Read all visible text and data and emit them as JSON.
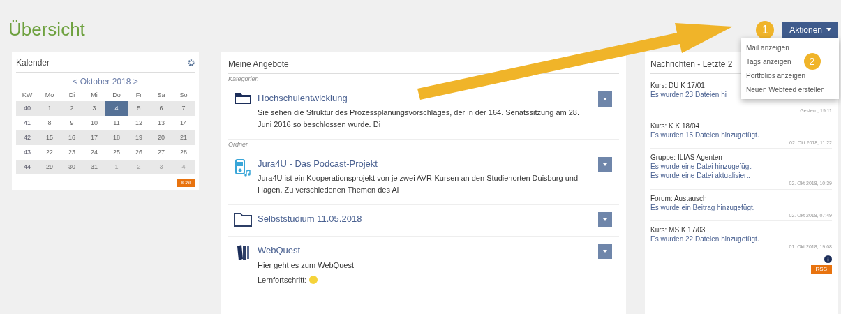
{
  "page": {
    "title": "Übersicht"
  },
  "callouts": [
    "1",
    "2"
  ],
  "actions": {
    "label": "Aktionen",
    "expanded": true,
    "menu": [
      "Mail anzeigen",
      "Tags anzeigen",
      "Portfolios anzeigen",
      "Neuen Webfeed erstellen"
    ]
  },
  "calendar": {
    "title": "Kalender",
    "month": "< Oktober 2018 >",
    "columns": [
      "KW",
      "Mo",
      "Di",
      "Mi",
      "Do",
      "Fr",
      "Sa",
      "So"
    ],
    "weeks": [
      {
        "kw": "40",
        "days": [
          {
            "label": "1",
            "selected": false,
            "other_month": false
          },
          {
            "label": "2",
            "selected": false,
            "other_month": false
          },
          {
            "label": "3",
            "selected": false,
            "other_month": false
          },
          {
            "label": "4",
            "selected": true,
            "other_month": false
          },
          {
            "label": "5",
            "selected": false,
            "other_month": false
          },
          {
            "label": "6",
            "selected": false,
            "other_month": false
          },
          {
            "label": "7",
            "selected": false,
            "other_month": false
          }
        ]
      },
      {
        "kw": "41",
        "days": [
          {
            "label": "8",
            "selected": false,
            "other_month": false
          },
          {
            "label": "9",
            "selected": false,
            "other_month": false
          },
          {
            "label": "10",
            "selected": false,
            "other_month": false
          },
          {
            "label": "11",
            "selected": false,
            "other_month": false
          },
          {
            "label": "12",
            "selected": false,
            "other_month": false
          },
          {
            "label": "13",
            "selected": false,
            "other_month": false
          },
          {
            "label": "14",
            "selected": false,
            "other_month": false
          }
        ]
      },
      {
        "kw": "42",
        "days": [
          {
            "label": "15",
            "selected": false,
            "other_month": false
          },
          {
            "label": "16",
            "selected": false,
            "other_month": false
          },
          {
            "label": "17",
            "selected": false,
            "other_month": false
          },
          {
            "label": "18",
            "selected": false,
            "other_month": false
          },
          {
            "label": "19",
            "selected": false,
            "other_month": false
          },
          {
            "label": "20",
            "selected": false,
            "other_month": false
          },
          {
            "label": "21",
            "selected": false,
            "other_month": false
          }
        ]
      },
      {
        "kw": "43",
        "days": [
          {
            "label": "22",
            "selected": false,
            "other_month": false
          },
          {
            "label": "23",
            "selected": false,
            "other_month": false
          },
          {
            "label": "24",
            "selected": false,
            "other_month": false
          },
          {
            "label": "25",
            "selected": false,
            "other_month": false
          },
          {
            "label": "26",
            "selected": false,
            "other_month": false
          },
          {
            "label": "27",
            "selected": false,
            "other_month": false
          },
          {
            "label": "28",
            "selected": false,
            "other_month": false
          }
        ]
      },
      {
        "kw": "44",
        "days": [
          {
            "label": "29",
            "selected": false,
            "other_month": false
          },
          {
            "label": "30",
            "selected": false,
            "other_month": false
          },
          {
            "label": "31",
            "selected": false,
            "other_month": false
          },
          {
            "label": "1",
            "selected": false,
            "other_month": true
          },
          {
            "label": "2",
            "selected": false,
            "other_month": true
          },
          {
            "label": "3",
            "selected": false,
            "other_month": true
          },
          {
            "label": "4",
            "selected": false,
            "other_month": true
          }
        ]
      }
    ],
    "ical": "iCal"
  },
  "offers": {
    "title": "Meine Angebote",
    "groups": [
      {
        "label": "Kategorien",
        "items": [
          {
            "kind": "category",
            "title": "Hochschulentwicklung",
            "description": "Sie sehen die Struktur des Prozessplanungsvorschlages, der in der 164. Senatssitzung am 28. Juni 2016 so beschlossen wurde. Di"
          }
        ]
      },
      {
        "label": "Ordner",
        "items": [
          {
            "kind": "podcast",
            "title": "Jura4U - Das Podcast-Projekt",
            "description": "Jura4U ist ein Kooperationsprojekt von je zwei AVR-Kursen an den Studienorten Duisburg und Hagen. Zu verschiedenen Themen des Al"
          },
          {
            "kind": "folder",
            "title": "Selbststudium 11.05.2018"
          },
          {
            "kind": "book",
            "title": "WebQuest",
            "description": "Hier geht es zum WebQuest",
            "progress": {
              "label": "Lernfortschritt:",
              "color": "#f5d33a"
            }
          }
        ]
      }
    ]
  },
  "news": {
    "title": "Nachrichten - Letzte 2",
    "items": [
      {
        "source": "Kurs: DU K 17/01",
        "lines": [
          "Es wurden 23 Dateien hi"
        ],
        "time": "Gestern, 19:11"
      },
      {
        "source": "Kurs: K K 18/04",
        "lines": [
          "Es wurden 15 Dateien hinzugefügt."
        ],
        "time": "02. Okt 2018, 11:22"
      },
      {
        "source": "Gruppe: ILIAS Agenten",
        "lines": [
          "Es wurde eine Datei hinzugefügt.",
          "Es wurde eine Datei aktualisiert."
        ],
        "time": "02. Okt 2018, 10:39"
      },
      {
        "source": "Forum: Austausch",
        "lines": [
          "Es wurde ein Beitrag hinzugefügt."
        ],
        "time": "02. Okt 2018, 07:49"
      },
      {
        "source": "Kurs: MS K 17/03",
        "lines": [
          "Es wurden 22 Dateien hinzugefügt."
        ],
        "time": "01. Okt 2018, 19:08"
      }
    ],
    "rss": "RSS"
  }
}
